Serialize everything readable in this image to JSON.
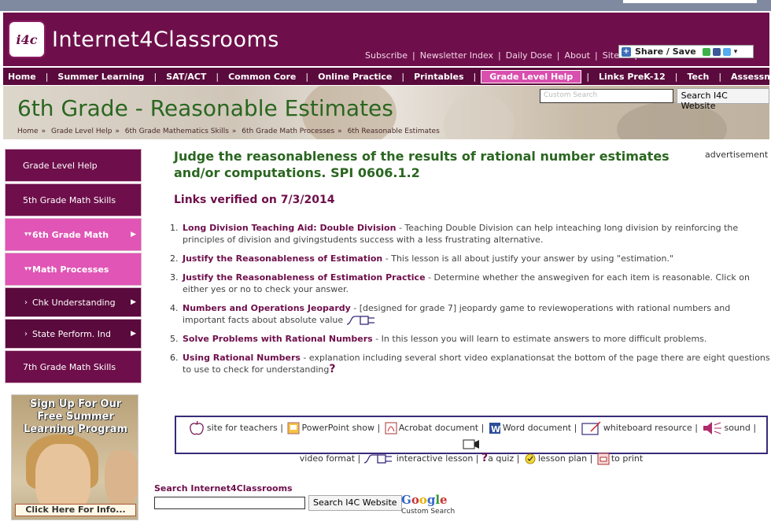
{
  "site": {
    "logo_badge": "i4c",
    "logo_text": "Internet4Classrooms"
  },
  "toplinks": [
    "Subscribe",
    "Newsletter Index",
    "Daily Dose",
    "About",
    "Site Map"
  ],
  "share": {
    "label": "Share / Save"
  },
  "nav": [
    "Home",
    "Summer Learning",
    "SAT/ACT",
    "Common Core",
    "Online Practice",
    "Printables",
    "Grade Level Help",
    "Links PreK-12",
    "Tech",
    "Assessment"
  ],
  "nav_active": "Grade Level Help",
  "banner": {
    "title": "6th Grade - Reasonable Estimates",
    "search_placeholder": "Custom Search",
    "search_button": "Search I4C Website",
    "breadcrumb": [
      "Home",
      "Grade Level Help",
      "6th Grade Mathematics Skills",
      "6th Grade Math Processes",
      "6th Reasonable Estimates"
    ]
  },
  "sidebar": [
    {
      "label": "Grade Level Help",
      "style": "normal"
    },
    {
      "label": "5th Grade Math Skills",
      "style": "normal"
    },
    {
      "label": "6th Grade Math",
      "style": "pink"
    },
    {
      "label": "Math Processes",
      "style": "pink"
    },
    {
      "label": "Chk Understanding",
      "style": "sub"
    },
    {
      "label": "State Perform. Ind",
      "style": "sub"
    },
    {
      "label": "7th Grade Math Skills",
      "style": "normal"
    }
  ],
  "promo": {
    "line1": "Sign Up For Our",
    "line2": "Free Summer",
    "line3": "Learning Program",
    "cta": "Click Here For Info..."
  },
  "main": {
    "heading": "Judge the reasonableness of the results of rational number estimates and/or computations. SPI 0606.1.2",
    "verified": "Links verified on 7/3/2014",
    "advertisement": "advertisement"
  },
  "links": [
    {
      "num": "1.",
      "title": "Long Division Teaching Aid: Double Division",
      "desc": " - Teaching Double Division can help inteaching long division by reinforcing the principles of division and givingstudents success with a less frustrating alternative."
    },
    {
      "num": "2.",
      "title": "Justify the Reasonableness of Estimation",
      "desc": " - This lesson is all about justify your answer by using \"estimation.\""
    },
    {
      "num": "3.",
      "title": "Justify the Reasonableness of Estimation Practice",
      "desc": " - Determine whether the answegiven for each item is reasonable. Click on either yes or no to check your answer."
    },
    {
      "num": "4.",
      "title": "Numbers and Operations Jeopardy",
      "desc": " - [designed for grade 7] jeopardy game to reviewoperations with rational numbers and important facts about absolute value"
    },
    {
      "num": "5.",
      "title": "Solve Problems with Rational Numbers",
      "desc": " - In this lesson you will learn to estimate answers to more difficult problems."
    },
    {
      "num": "6.",
      "title": "Using Rational Numbers",
      "desc": " - explanation including several short video explanationsat the bottom of the page there are eight questions to use to check for understanding"
    }
  ],
  "legend": {
    "site_for_teachers": "site for teachers",
    "powerpoint": "PowerPoint show",
    "acrobat": "Acrobat document",
    "word": "Word document",
    "whiteboard": "whiteboard resource",
    "sound": "sound",
    "video": "video format",
    "interactive": "interactive lesson",
    "quiz": "a quiz",
    "lesson_plan": "lesson plan",
    "print": "to print"
  },
  "bottom_search": {
    "label": "Search Internet4Classrooms",
    "button": "Search I4C Website",
    "google": "Google",
    "google_sub": "Custom Search"
  },
  "colors": {
    "brand": "#6e0f4b",
    "accent_pink": "#e055b5",
    "heading_green": "#2a6620"
  }
}
